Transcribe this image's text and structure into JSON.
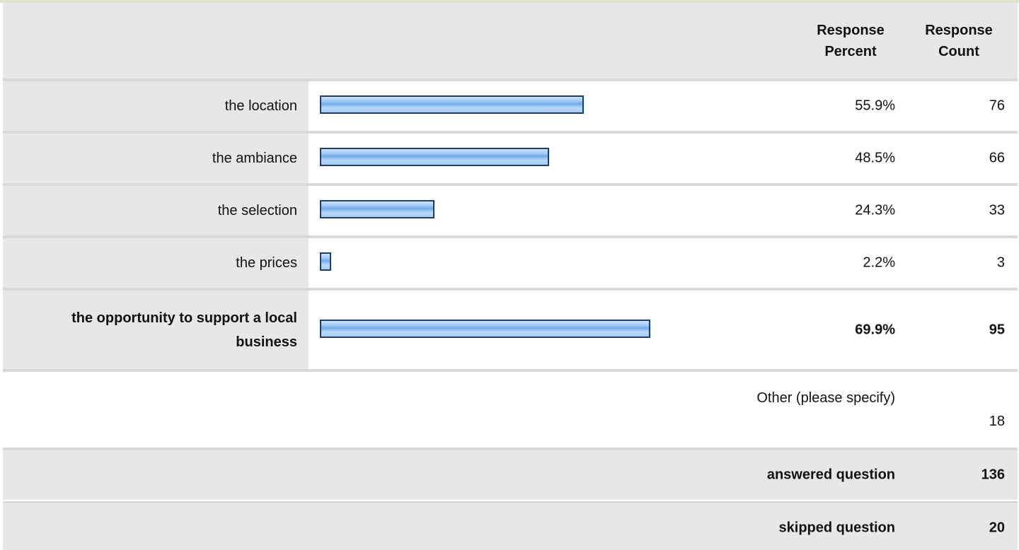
{
  "header": {
    "percent_label": "Response Percent",
    "count_label": "Response Count"
  },
  "rows": [
    {
      "label": "the location",
      "percent": "55.9%",
      "count": "76",
      "fraction": 0.559
    },
    {
      "label": "the ambiance",
      "percent": "48.5%",
      "count": "66",
      "fraction": 0.485
    },
    {
      "label": "the selection",
      "percent": "24.3%",
      "count": "33",
      "fraction": 0.243
    },
    {
      "label": "the prices",
      "percent": "2.2%",
      "count": "3",
      "fraction": 0.022
    },
    {
      "label": "the opportunity to support a local business",
      "percent": "69.9%",
      "count": "95",
      "fraction": 0.699,
      "bold": true
    }
  ],
  "other": {
    "label": "Other (please specify)",
    "count": "18"
  },
  "summary": {
    "answered_label": "answered question",
    "answered_value": "136",
    "skipped_label": "skipped question",
    "skipped_value": "20"
  },
  "colors": {
    "bar_border": "#1e3f6e",
    "bar_fill": "#8bbcf0",
    "label_bg": "#e7e7e7",
    "divider": "#d9d9d9"
  },
  "chart_data": {
    "type": "bar",
    "categories": [
      "the location",
      "the ambiance",
      "the selection",
      "the prices",
      "the opportunity to support a local business"
    ],
    "series": [
      {
        "values": [
          55.9,
          48.5,
          24.3,
          2.2,
          69.9
        ]
      }
    ],
    "counts": [
      76,
      66,
      33,
      3,
      95
    ],
    "xlim": [
      0,
      100
    ]
  }
}
